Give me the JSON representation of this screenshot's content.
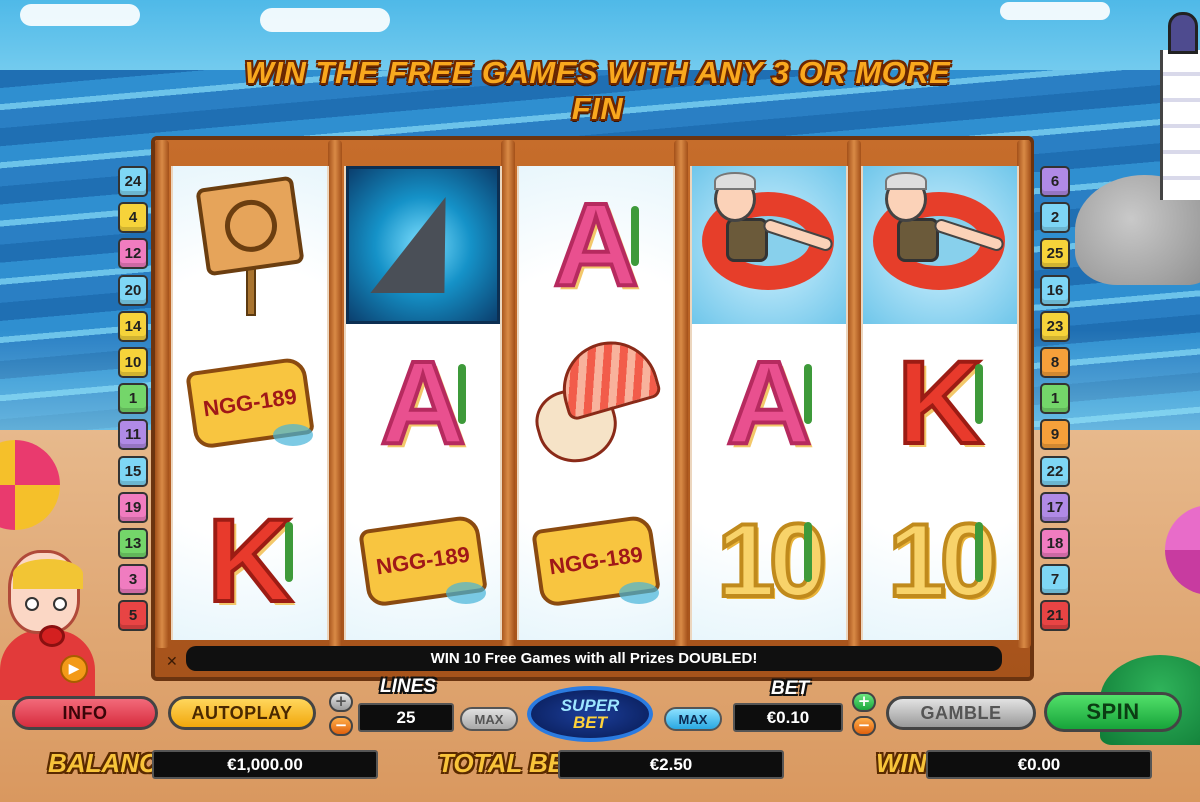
{
  "banner": "WIN THE FREE GAMES WITH ANY 3 OR MORE FIN",
  "message": "WIN 10 Free Games with all Prizes DOUBLED!",
  "lines_left": [
    "24",
    "4",
    "12",
    "20",
    "14",
    "10",
    "1",
    "11",
    "15",
    "19",
    "13",
    "3",
    "5"
  ],
  "lines_left_colors": [
    "#7ed6f5",
    "#f6d33a",
    "#f07cc0",
    "#7ed6f5",
    "#f6d33a",
    "#f6d33a",
    "#74d66a",
    "#b08ae6",
    "#7ed6f5",
    "#f07cc0",
    "#74d66a",
    "#f07cc0",
    "#e84444"
  ],
  "lines_right": [
    "6",
    "2",
    "25",
    "16",
    "23",
    "8",
    "1",
    "9",
    "22",
    "17",
    "18",
    "7",
    "21"
  ],
  "lines_right_colors": [
    "#b08ae6",
    "#7ed6f5",
    "#f6d33a",
    "#7ed6f5",
    "#f6d33a",
    "#f6a03a",
    "#74d66a",
    "#f6a03a",
    "#7ed6f5",
    "#b08ae6",
    "#f07cc0",
    "#7ed6f5",
    "#e84444"
  ],
  "reels": [
    [
      "sign",
      "plate",
      "K"
    ],
    [
      "fin",
      "A",
      "plate"
    ],
    [
      "A",
      "jellyfish",
      "plate"
    ],
    [
      "float",
      "A",
      "10"
    ],
    [
      "float",
      "K",
      "10"
    ]
  ],
  "plate_text": "NGG-189",
  "controls": {
    "info": "INFO",
    "autoplay": "AUTOPLAY",
    "lines_label": "LINES",
    "lines_value": "25",
    "max_lines": "MAX",
    "superbet_1": "SUPER",
    "superbet_2": "BET",
    "max_bet": "MAX",
    "bet_label": "BET",
    "bet_value": "€0.10",
    "gamble": "GAMBLE",
    "spin": "SPIN",
    "minus": "−",
    "plus": "+"
  },
  "footer": {
    "balance_label": "BALANCE",
    "balance_value": "€1,000.00",
    "total_bet_label": "TOTAL BET",
    "total_bet_value": "€2.50",
    "win_label": "WIN",
    "win_value": "€0.00"
  }
}
